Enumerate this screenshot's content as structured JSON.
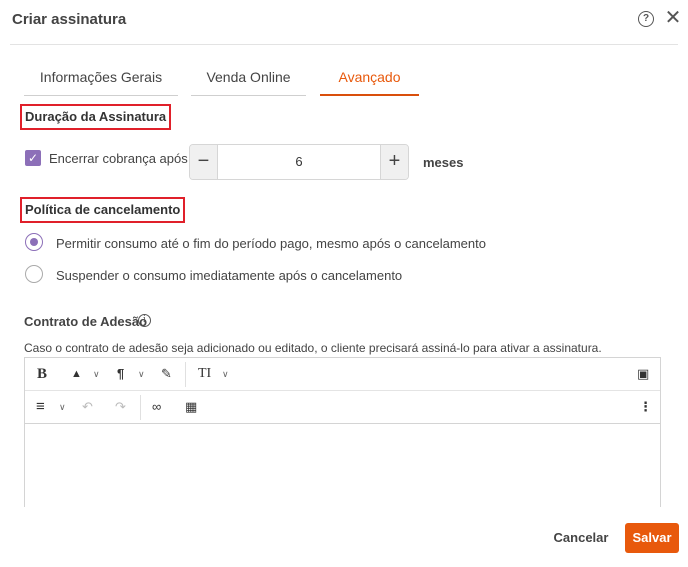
{
  "dialog": {
    "title": "Criar assinatura",
    "help_icon": "question-circle-icon",
    "close_icon": "close-icon"
  },
  "tabs": [
    {
      "label": "Informações Gerais",
      "active": false
    },
    {
      "label": "Venda Online",
      "active": false
    },
    {
      "label": "Avançado",
      "active": true
    }
  ],
  "duration": {
    "section_title": "Duração da Assinatura",
    "checkbox_label": "Encerrar cobrança após",
    "checkbox_checked": true,
    "stepper_value": "6",
    "minus_label": "−",
    "plus_label": "+",
    "unit_label": "meses"
  },
  "cancellation": {
    "section_title": "Política de cancelamento",
    "options": [
      {
        "label": "Permitir consumo até o fim do período pago, mesmo após o cancelamento",
        "selected": true
      },
      {
        "label": "Suspender o consumo imediatamente após o cancelamento",
        "selected": false
      }
    ]
  },
  "contract": {
    "label": "Contrato de Adesão",
    "info_icon": "info-icon",
    "description": "Caso o contrato de adesão seja adicionado ou editado, o cliente precisará assiná-lo para ativar a assinatura.",
    "toolbar": {
      "bold": "B",
      "color": "▲",
      "paragraph": "¶",
      "eraser": "✎",
      "font_size": "TI",
      "image": "▣",
      "align": "≡",
      "undo": "↶",
      "redo": "↷",
      "link": "∞",
      "table": "▦",
      "more": "⋮",
      "caret": "∨"
    }
  },
  "footer": {
    "cancel_label": "Cancelar",
    "save_label": "Salvar"
  },
  "colors": {
    "accent": "#e8590c",
    "checkbox": "#8c6fb8",
    "highlight_border": "#e0202a"
  }
}
